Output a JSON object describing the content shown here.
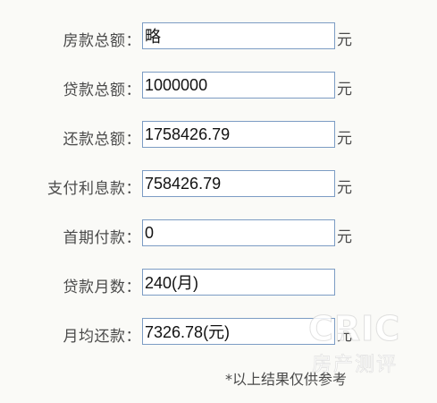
{
  "rows": [
    {
      "label": "房款总额：",
      "value": "略",
      "unit": "元"
    },
    {
      "label": "贷款总额：",
      "value": "1000000",
      "unit": "元"
    },
    {
      "label": "还款总额：",
      "value": "1758426.79",
      "unit": "元"
    },
    {
      "label": "支付利息款：",
      "value": "758426.79",
      "unit": "元"
    },
    {
      "label": "首期付款：",
      "value": "0",
      "unit": "元"
    },
    {
      "label": "贷款月数：",
      "value": "240(月)",
      "unit": ""
    },
    {
      "label": "月均还款：",
      "value": "7326.78(元)",
      "unit": "元"
    }
  ],
  "note": "*以上结果仅供参考",
  "watermark": {
    "logo": "CRIC",
    "sub": "房产测评"
  },
  "colors": {
    "field_border": "#7c9cc4",
    "background": "#fafaf7"
  }
}
